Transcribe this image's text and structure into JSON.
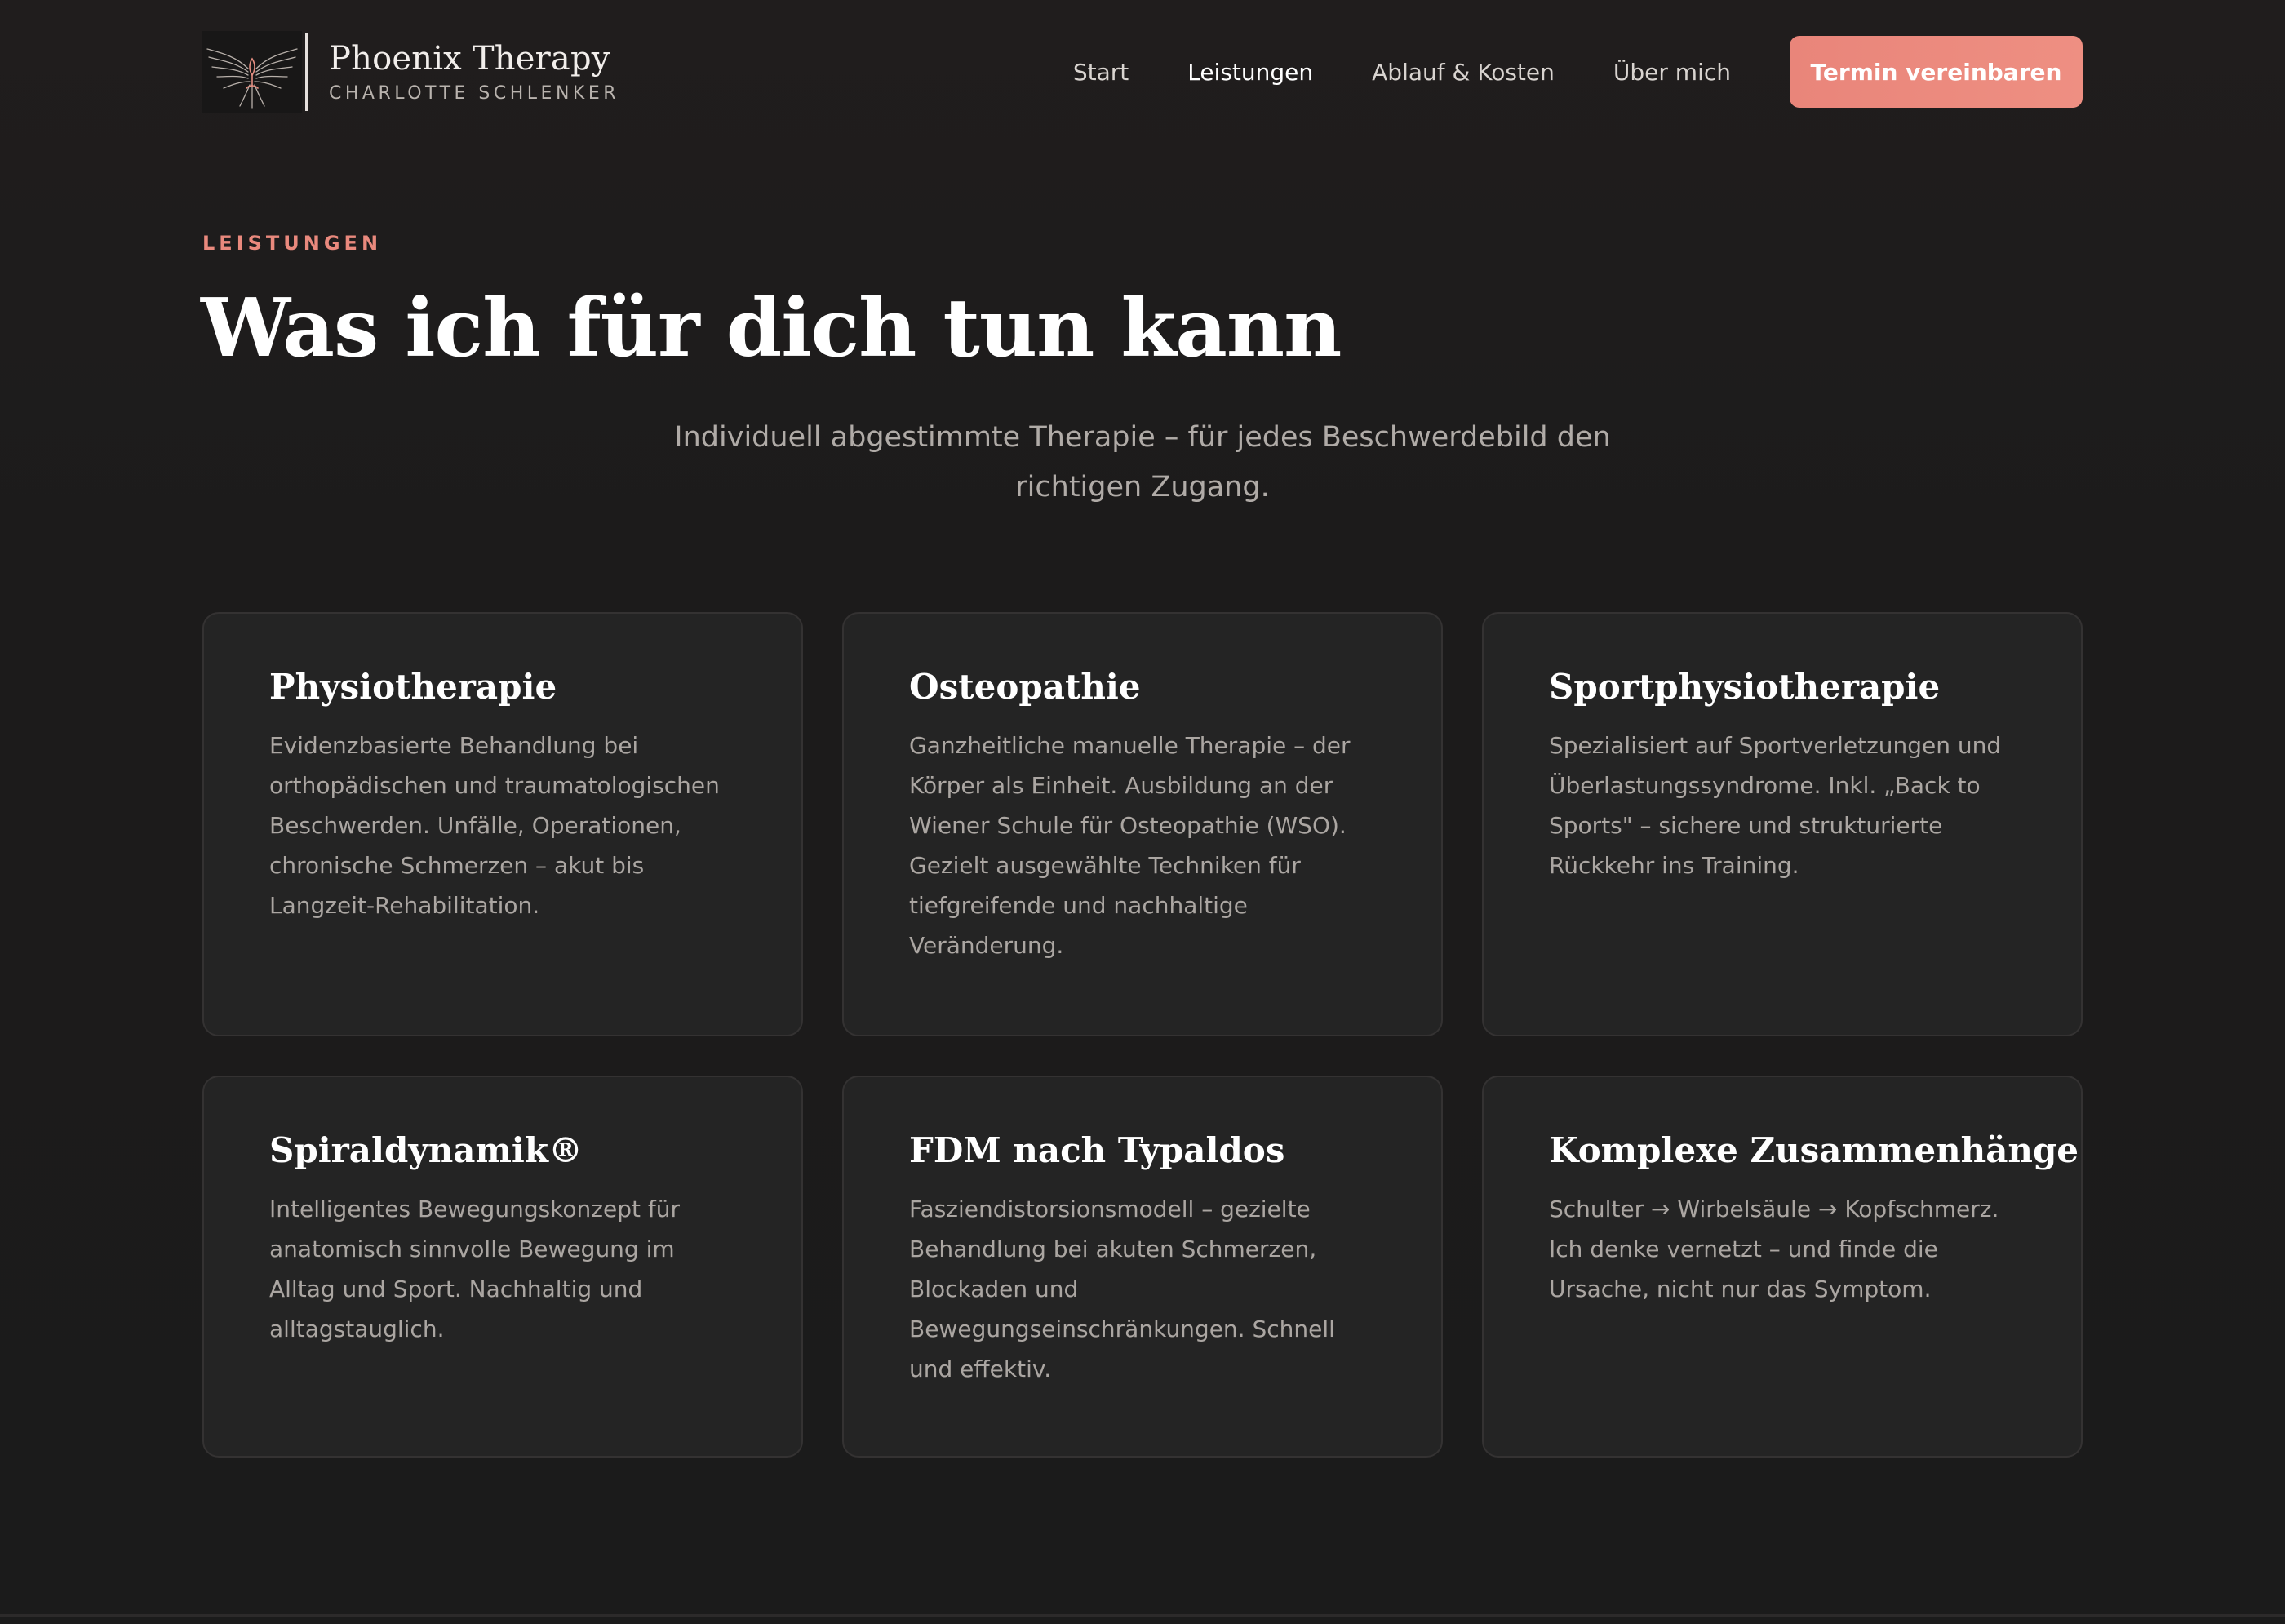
{
  "brand": {
    "name": "Phoenix Therapy",
    "subtitle": "CHARLOTTE SCHLENKER",
    "logo_icon": "phoenix-logo-icon"
  },
  "nav": {
    "items": [
      {
        "label": "Start",
        "active": false
      },
      {
        "label": "Leistungen",
        "active": true
      },
      {
        "label": "Ablauf & Kosten",
        "active": false
      },
      {
        "label": "Über mich",
        "active": false
      }
    ],
    "cta_label": "Termin vereinbaren"
  },
  "hero": {
    "eyebrow": "LEISTUNGEN",
    "title": "Was ich für dich tun kann",
    "subtitle": "Individuell abgestimmte Therapie – für jedes Beschwerdebild den richtigen Zugang."
  },
  "services": [
    {
      "title": "Physiotherapie",
      "text": "Evidenzbasierte Behandlung bei orthopädischen und traumatologischen Beschwerden. Unfälle, Operationen, chronische Schmerzen – akut bis Langzeit-Rehabilitation."
    },
    {
      "title": "Osteopathie",
      "text": "Ganzheitliche manuelle Therapie – der Körper als Einheit. Ausbildung an der Wiener Schule für Osteopathie (WSO). Gezielt ausgewählte Techniken für tiefgreifende und nachhaltige Veränderung."
    },
    {
      "title": "Sportphysiotherapie",
      "text": "Spezialisiert auf Sportverletzungen und Überlastungssyndrome. Inkl. „Back to Sports\" – sichere und strukturierte Rückkehr ins Training."
    },
    {
      "title": "Spiraldynamik®",
      "text": "Intelligentes Bewegungskonzept für anatomisch sinnvolle Bewegung im Alltag und Sport. Nachhaltig und alltagstauglich."
    },
    {
      "title": "FDM nach Typaldos",
      "text": "Fasziendistorsionsmodell – gezielte Behandlung bei akuten Schmerzen, Blockaden und Bewegungseinschränkungen. Schnell und effektiv."
    },
    {
      "title": "Komplexe Zusammenhänge",
      "text": "Schulter → Wirbelsäule → Kopfschmerz. Ich denke vernetzt – und finde die Ursache, nicht nur das Symptom."
    }
  ],
  "colors": {
    "background": "#1c1b1b",
    "accent": "#ee8f82",
    "card_background": "#242424",
    "card_border": "#343232",
    "body_text": "#aba6a2"
  }
}
